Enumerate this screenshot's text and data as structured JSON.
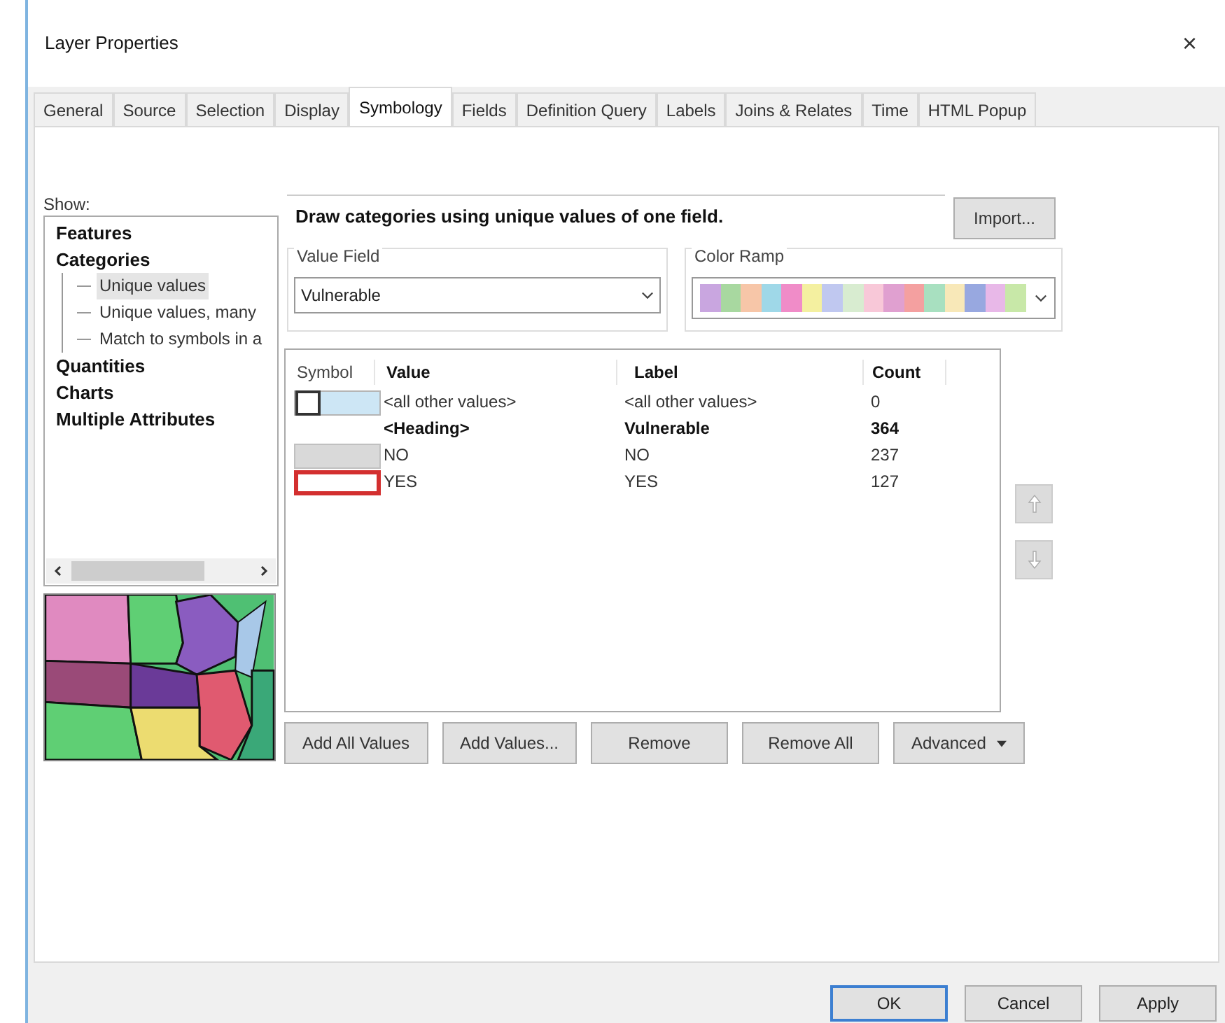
{
  "window": {
    "title": "Layer Properties",
    "close": "×"
  },
  "tabs": [
    {
      "label": "General",
      "selected": false
    },
    {
      "label": "Source",
      "selected": false
    },
    {
      "label": "Selection",
      "selected": false
    },
    {
      "label": "Display",
      "selected": false
    },
    {
      "label": "Symbology",
      "selected": true
    },
    {
      "label": "Fields",
      "selected": false
    },
    {
      "label": "Definition Query",
      "selected": false
    },
    {
      "label": "Labels",
      "selected": false
    },
    {
      "label": "Joins & Relates",
      "selected": false
    },
    {
      "label": "Time",
      "selected": false
    },
    {
      "label": "HTML Popup",
      "selected": false
    }
  ],
  "show": {
    "label": "Show:",
    "items": [
      {
        "label": "Features",
        "selected": false
      },
      {
        "label": "Categories",
        "selected": false,
        "children": [
          {
            "label": "Unique values",
            "selected": true
          },
          {
            "label": "Unique values, many",
            "selected": false
          },
          {
            "label": "Match to symbols in a",
            "selected": false
          }
        ]
      },
      {
        "label": "Quantities",
        "selected": false
      },
      {
        "label": "Charts",
        "selected": false
      },
      {
        "label": "Multiple Attributes",
        "selected": false
      }
    ]
  },
  "description": "Draw categories using unique values of one field.",
  "import_button": "Import...",
  "value_field": {
    "label": "Value Field",
    "value": "Vulnerable"
  },
  "color_ramp": {
    "label": "Color Ramp"
  },
  "table": {
    "columns": [
      "Symbol",
      "Value",
      "Label",
      "Count"
    ],
    "rows": [
      {
        "kind": "normal",
        "symbol": {
          "kind": "default",
          "color": "#cde6f5"
        },
        "value": "<all other values>",
        "label": "<all other values>",
        "count": "0"
      },
      {
        "kind": "heading",
        "value": "<Heading>",
        "label": "Vulnerable",
        "count": "364"
      },
      {
        "kind": "normal",
        "symbol": {
          "kind": "fill",
          "color": "#d9d9d9"
        },
        "value": "NO",
        "label": "NO",
        "count": "237"
      },
      {
        "kind": "normal",
        "symbol": {
          "kind": "outline",
          "color": "#d32f2f"
        },
        "value": "YES",
        "label": "YES",
        "count": "127"
      }
    ]
  },
  "action_buttons": [
    "Add All Values",
    "Add Values...",
    "Remove",
    "Remove All",
    "Advanced"
  ],
  "footer_buttons": [
    {
      "label": "OK",
      "default": true
    },
    {
      "label": "Cancel",
      "default": false
    },
    {
      "label": "Apply",
      "default": false
    }
  ]
}
